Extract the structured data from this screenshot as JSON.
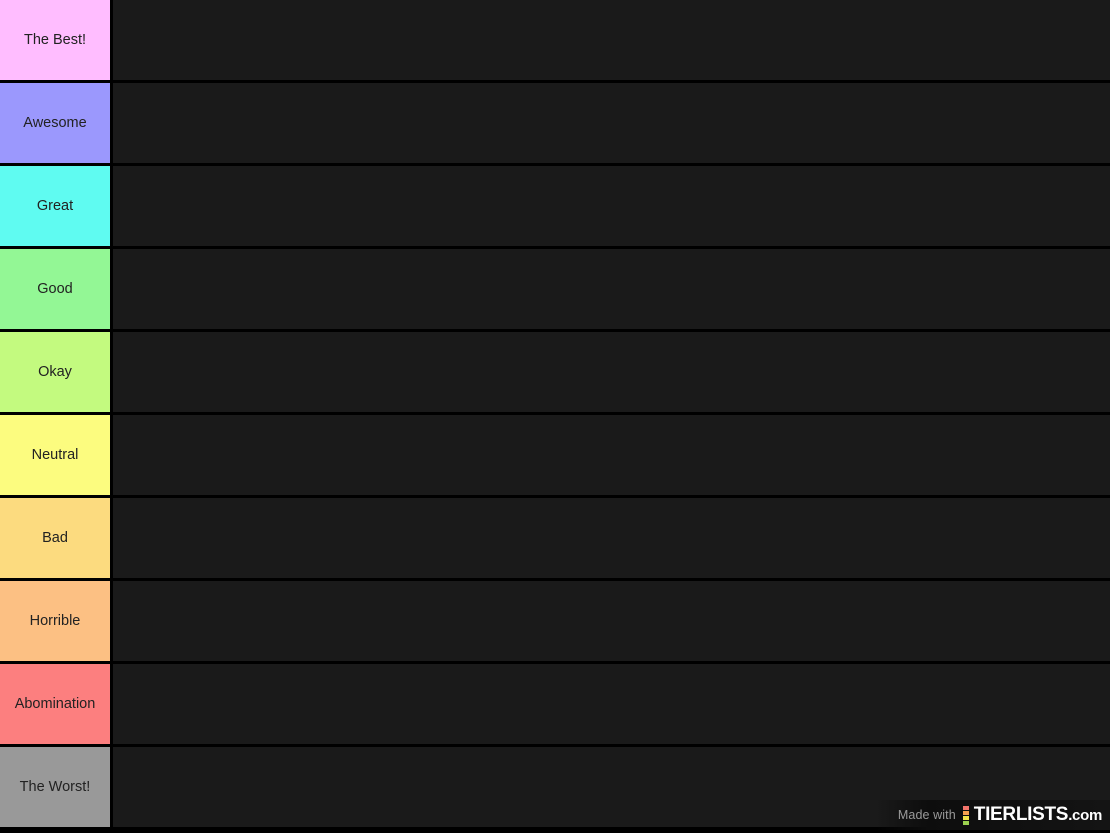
{
  "tier_list": {
    "rows": [
      {
        "label": "The Best!",
        "color": "#ffbdff",
        "text_color": "#222222",
        "items": []
      },
      {
        "label": "Awesome",
        "color": "#9b98fd",
        "text_color": "#222222",
        "items": []
      },
      {
        "label": "Great",
        "color": "#5ffbf1",
        "text_color": "#222222",
        "items": []
      },
      {
        "label": "Good",
        "color": "#93f795",
        "text_color": "#222222",
        "items": []
      },
      {
        "label": "Okay",
        "color": "#c3fa7f",
        "text_color": "#222222",
        "items": []
      },
      {
        "label": "Neutral",
        "color": "#fcfc7f",
        "text_color": "#222222",
        "items": []
      },
      {
        "label": "Bad",
        "color": "#fcdb7f",
        "text_color": "#222222",
        "items": []
      },
      {
        "label": "Horrible",
        "color": "#fcc083",
        "text_color": "#222222",
        "items": []
      },
      {
        "label": "Abomination",
        "color": "#fc7f7f",
        "text_color": "#222222",
        "items": []
      },
      {
        "label": "The Worst!",
        "color": "#999999",
        "text_color": "#222222",
        "items": []
      }
    ],
    "row_background": "#1a1a1a",
    "grid_color": "#000000"
  },
  "watermark": {
    "made_with": "Made with",
    "brand": "TIERLISTS",
    "brand_suffix": ".com",
    "logo_colors": [
      "#f2746b",
      "#f5a04f",
      "#f2e44b",
      "#9bd14f"
    ]
  }
}
